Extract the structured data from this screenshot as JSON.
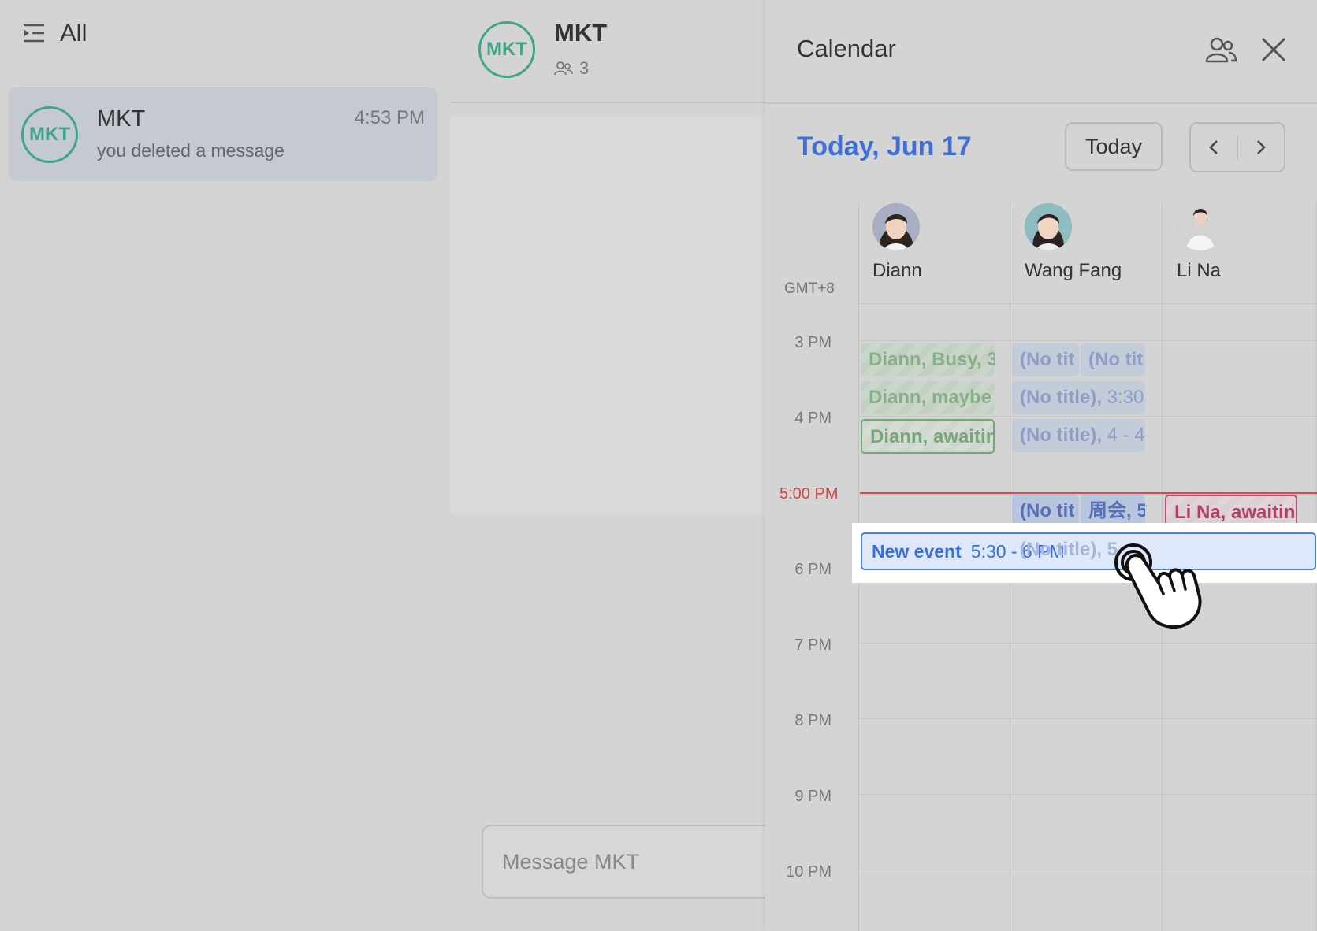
{
  "sidebar": {
    "filter_label": "All",
    "chat": {
      "avatar_text": "MKT",
      "name": "MKT",
      "time": "4:53 PM",
      "preview": "you deleted a message"
    }
  },
  "conversation": {
    "avatar_text": "MKT",
    "title": "MKT",
    "member_count": "3",
    "input_placeholder": "Message MKT"
  },
  "calendar": {
    "title": "Calendar",
    "date_label": "Today, Jun 17",
    "today_button": "Today",
    "timezone": "GMT+8",
    "people": [
      {
        "name": "Diann"
      },
      {
        "name": "Wang Fang"
      },
      {
        "name": "Li Na"
      }
    ],
    "hours": [
      "3 PM",
      "4 PM",
      "5:00 PM",
      "6 PM",
      "7 PM",
      "8 PM",
      "9 PM",
      "10 PM"
    ],
    "events": {
      "diann_busy": "Diann, Busy, 3",
      "diann_maybe": "Diann, maybe",
      "diann_awaiting": "Diann, awaitin",
      "wf_notitle_a": "(No tit",
      "wf_notitle_b": "(No tit",
      "wf_notitle_330_title": "(No title),",
      "wf_notitle_330_time": "3:30",
      "wf_notitle_4_title": "(No title),",
      "wf_notitle_4_time": "4 - 4",
      "wf_notitle_5": "(No tit",
      "wf_weekly": "周会, 5",
      "wf_ghost": "(No title), 5",
      "lina_awaiting": "Li Na, awaitin"
    },
    "new_event": {
      "label": "New event",
      "time": "5:30 - 6 PM"
    }
  },
  "colors": {
    "accent": "#3f6fd6",
    "brand_teal": "#3fa58b",
    "now_red": "#d64a4a"
  }
}
